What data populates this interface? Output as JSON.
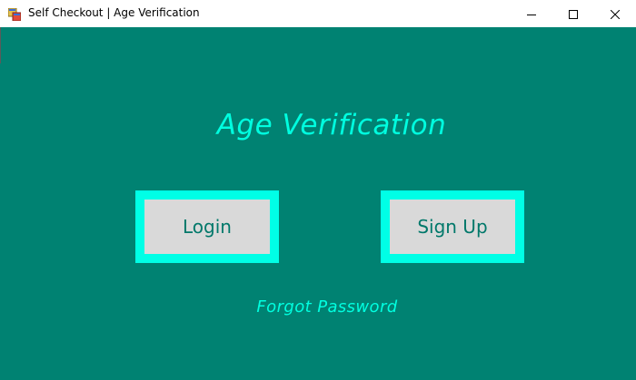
{
  "window": {
    "title": "Self Checkout | Age Verification",
    "icon": "app-form-icon",
    "controls": {
      "minimize_icon": "minimize-icon",
      "maximize_icon": "maximize-icon",
      "close_icon": "close-icon"
    }
  },
  "main": {
    "heading": "Age Verification",
    "login_label": "Login",
    "signup_label": "Sign Up",
    "forgot_password_label": "Forgot Password"
  },
  "colors": {
    "background": "#008272",
    "accent": "#00FFE0",
    "button_face": "#D9D9D9",
    "button_text": "#00786A"
  }
}
